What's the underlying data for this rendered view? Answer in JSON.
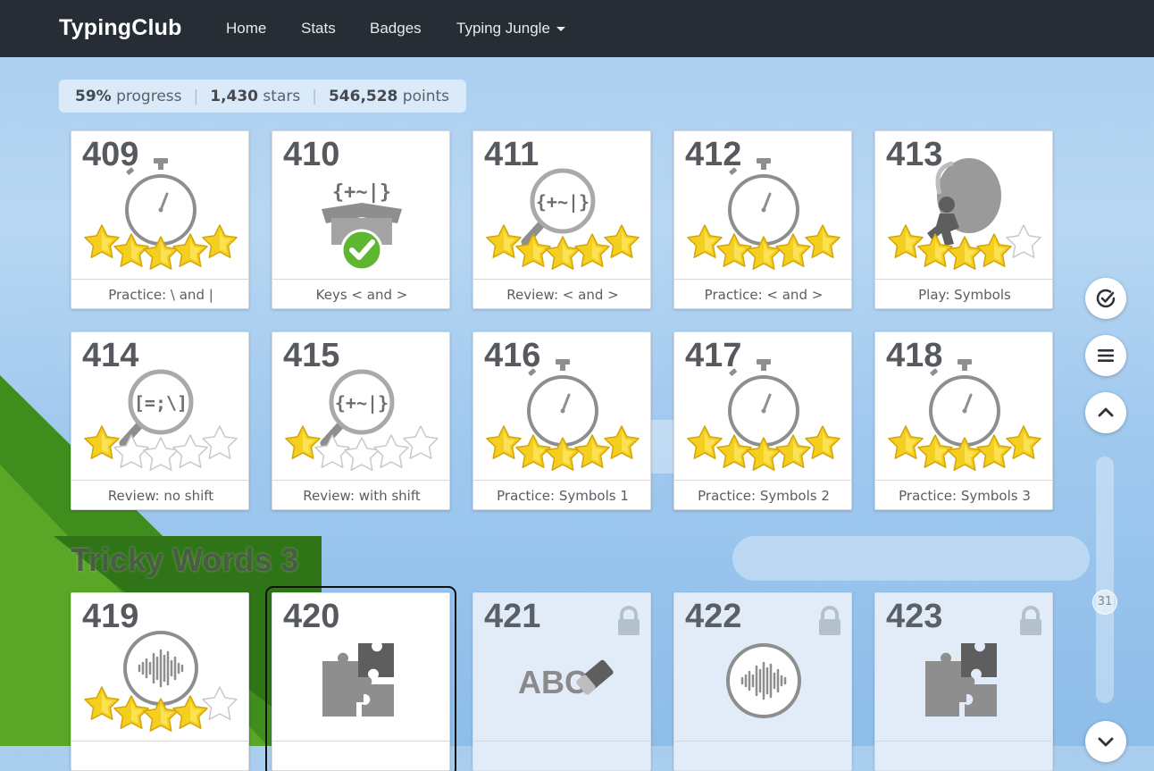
{
  "navbar": {
    "brand": "TypingClub",
    "links": [
      "Home",
      "Stats",
      "Badges",
      "Typing Jungle"
    ]
  },
  "summary": {
    "progress_value": "59%",
    "progress_label": "progress",
    "stars_value": "1,430",
    "stars_label": "stars",
    "points_value": "546,528",
    "points_label": "points"
  },
  "cards": [
    {
      "number": "409",
      "title": "Practice: \\ and |",
      "icon": "stopwatch-icon",
      "stars": 5,
      "locked": false
    },
    {
      "number": "410",
      "title": "Keys < and >",
      "icon": "symbols-box-icon",
      "stars": 0,
      "completed": true,
      "locked": false
    },
    {
      "number": "411",
      "title": "Review: < and >",
      "icon": "magnifier-symbols-icon",
      "stars": 5,
      "locked": false
    },
    {
      "number": "412",
      "title": "Practice: < and >",
      "icon": "stopwatch-icon",
      "stars": 5,
      "locked": false
    },
    {
      "number": "413",
      "title": "Play: Symbols",
      "icon": "hot-air-balloon-game-icon",
      "stars": 4,
      "locked": false
    },
    {
      "number": "414",
      "title": "Review: no shift",
      "icon": "magnifier-symbols-icon",
      "stars": 1,
      "locked": false
    },
    {
      "number": "415",
      "title": "Review: with shift",
      "icon": "magnifier-symbols-icon",
      "stars": 1,
      "locked": false
    },
    {
      "number": "416",
      "title": "Practice: Symbols 1",
      "icon": "stopwatch-icon",
      "stars": 5,
      "locked": false
    },
    {
      "number": "417",
      "title": "Practice: Symbols 2",
      "icon": "stopwatch-icon",
      "stars": 5,
      "locked": false
    },
    {
      "number": "418",
      "title": "Practice: Symbols 3",
      "icon": "stopwatch-icon",
      "stars": 5,
      "locked": false
    },
    {
      "number": "419",
      "title": "",
      "icon": "audio-wave-icon",
      "stars": 4,
      "locked": false
    },
    {
      "number": "420",
      "title": "",
      "icon": "puzzle-icon",
      "stars": 0,
      "locked": false,
      "selected": true
    },
    {
      "number": "421",
      "title": "",
      "icon": "abc-eraser-icon",
      "stars": 0,
      "locked": true
    },
    {
      "number": "422",
      "title": "",
      "icon": "audio-wave-icon",
      "stars": 0,
      "locked": true
    },
    {
      "number": "423",
      "title": "",
      "icon": "puzzle-icon",
      "stars": 0,
      "locked": true
    }
  ],
  "section": {
    "title": "Tricky Words 3"
  },
  "icon_text": {
    "box_symbols": "{+~|}",
    "mag_symbols_a": "{+~|}",
    "mag_symbols_b": "[=;\\]",
    "abc": "ABC"
  },
  "sidebar": {
    "level_indicator": "31",
    "buttons": [
      "check-circle-icon",
      "menu-icon",
      "chevron-up-icon",
      "chevron-down-icon"
    ]
  },
  "colors": {
    "navbar": "#272d35",
    "star_fill": "#f5cf1f",
    "check_green": "#5fb731",
    "icon_gray": "#8a8a8a"
  }
}
